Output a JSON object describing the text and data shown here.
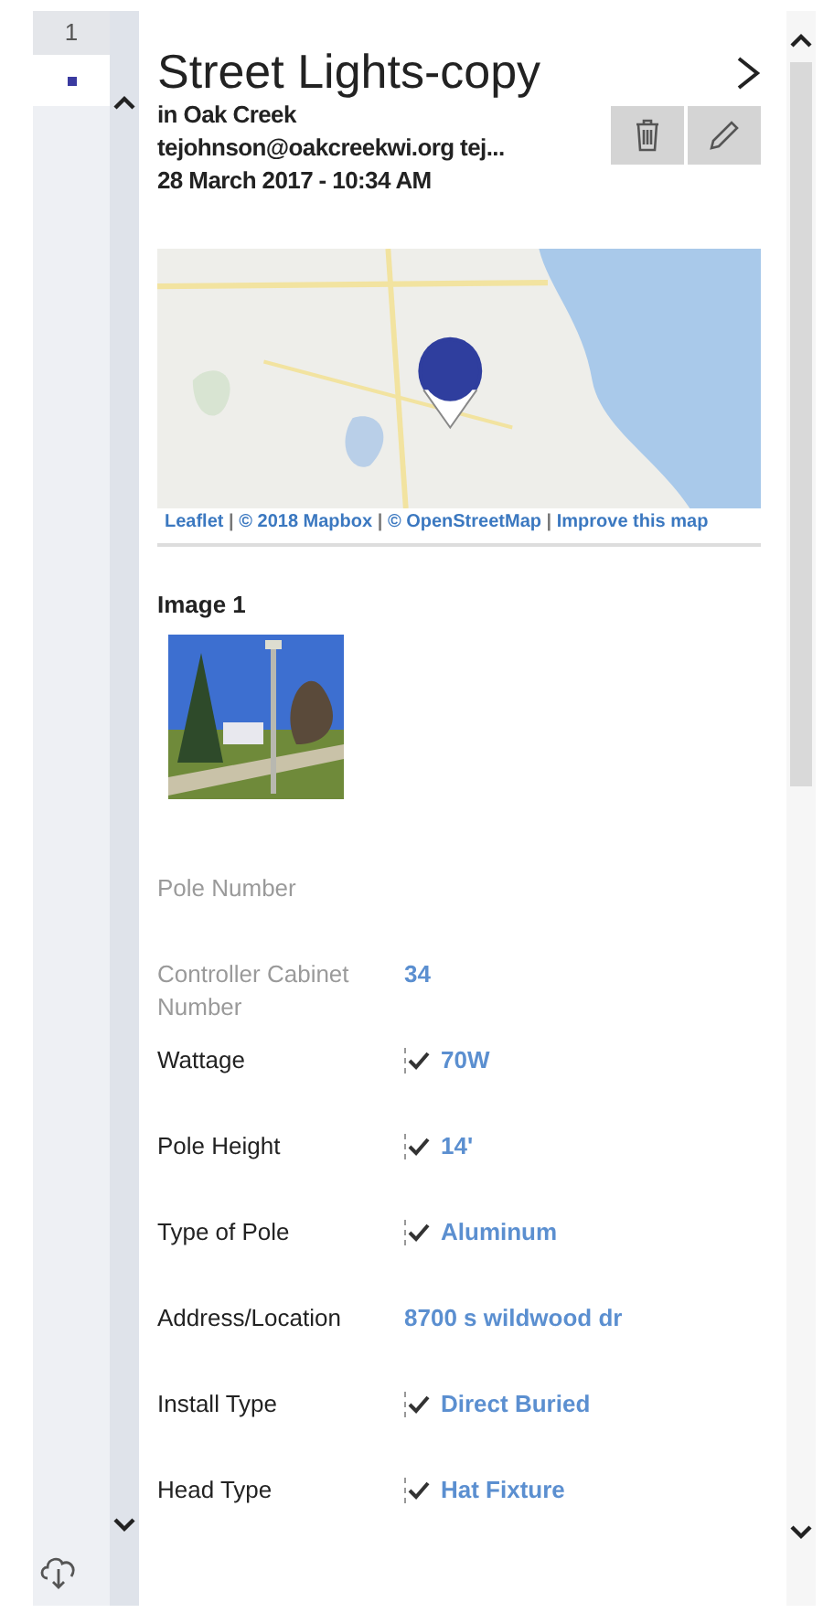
{
  "sidebar": {
    "tab": "1",
    "selected": true
  },
  "record": {
    "title": "Street Lights-copy",
    "location": "in Oak Creek",
    "author": "tejohnson@oakcreekwi.org tej...",
    "date": "28 March 2017 - 10:34 AM"
  },
  "map": {
    "attribution": [
      {
        "kind": "link",
        "text": "Leaflet"
      },
      {
        "kind": "sep",
        "text": "|"
      },
      {
        "kind": "link",
        "text": "© 2018 Mapbox"
      },
      {
        "kind": "sep",
        "text": "|"
      },
      {
        "kind": "link",
        "text": "© OpenStreetMap"
      },
      {
        "kind": "sep",
        "text": "|"
      },
      {
        "kind": "link",
        "text": "Improve this map"
      }
    ]
  },
  "images": [
    {
      "label": "Image 1",
      "kind": "picture"
    }
  ],
  "fields": [
    {
      "label": "Pole Number",
      "disabled": true,
      "kind": "text"
    },
    {
      "label": "Controller Cabinet Number",
      "disabled": true,
      "kind": "text",
      "value": "34"
    },
    {
      "label": "Wattage",
      "disabled": false,
      "kind": "check",
      "checked": true,
      "value": "70W"
    },
    {
      "label": "Pole Height",
      "disabled": false,
      "kind": "check",
      "checked": true,
      "value": "14'"
    },
    {
      "label": "Type of Pole",
      "disabled": false,
      "kind": "check",
      "checked": true,
      "value": "Aluminum"
    },
    {
      "label": "Address/Location",
      "disabled": false,
      "kind": "text",
      "value": "8700 s wildwood dr"
    },
    {
      "label": "Install Type",
      "disabled": false,
      "kind": "check",
      "checked": true,
      "value": "Direct Buried"
    },
    {
      "label": "Head Type",
      "disabled": false,
      "kind": "check",
      "checked": true,
      "value": "Hat Fixture"
    }
  ]
}
